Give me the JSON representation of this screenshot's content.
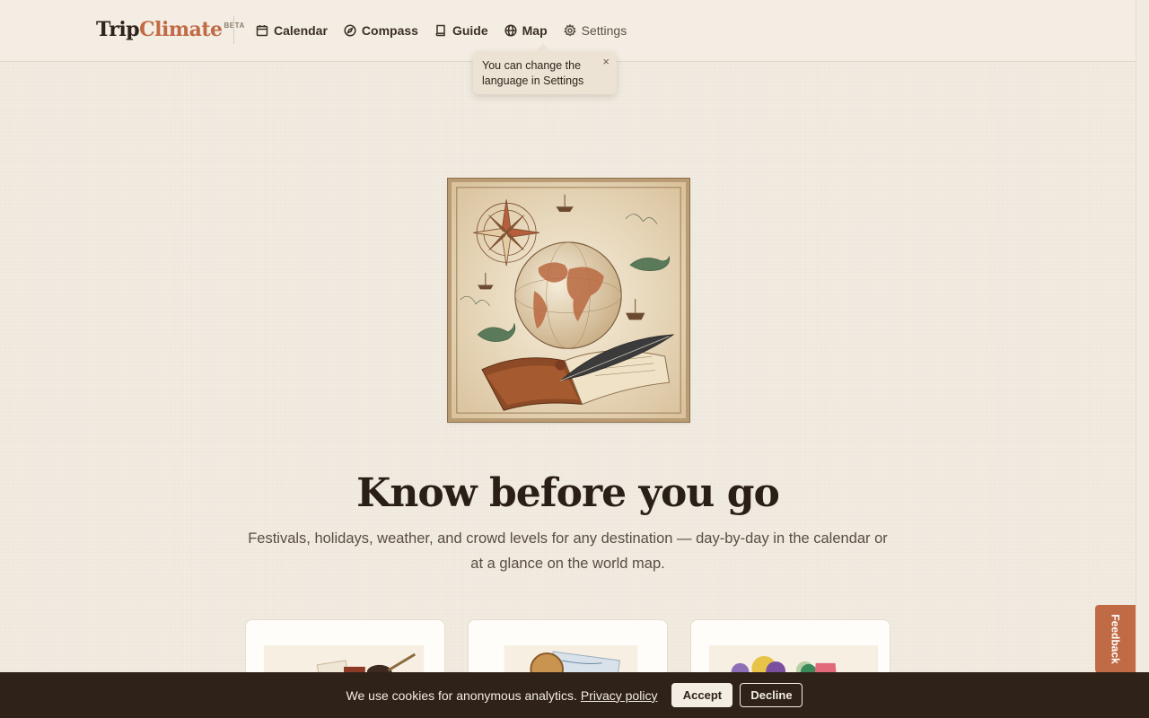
{
  "header": {
    "logo_trip": "Trip",
    "logo_climate": "Climate",
    "logo_badge": "BETA",
    "nav": [
      {
        "label": "Calendar",
        "icon": "calendar-icon"
      },
      {
        "label": "Compass",
        "icon": "compass-icon"
      },
      {
        "label": "Guide",
        "icon": "book-icon"
      },
      {
        "label": "Map",
        "icon": "globe-icon"
      },
      {
        "label": "Settings",
        "icon": "gear-icon"
      }
    ]
  },
  "tooltip": {
    "text": "You can change the language in Settings",
    "close": "×"
  },
  "hero": {
    "title": "Know before you go",
    "subtitle": "Festivals, holidays, weather, and crowd levels for any destination — day-by-day in the calendar or at a glance on the world map."
  },
  "feedback": {
    "label": "Feedback"
  },
  "cookie": {
    "text": "We use cookies for anonymous analytics.",
    "link": "Privacy policy",
    "accept": "Accept",
    "decline": "Decline"
  },
  "colors": {
    "background": "#f1ebe1",
    "accent": "#c16b46",
    "text": "#2e241b",
    "cookie_bar": "#2f2218"
  }
}
